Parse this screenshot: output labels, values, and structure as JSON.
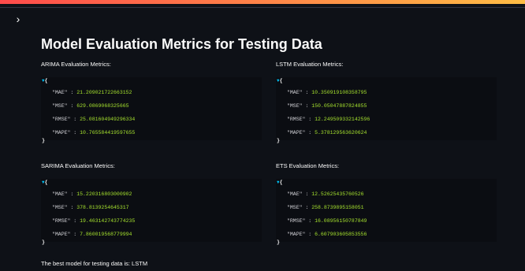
{
  "page": {
    "title": "Model Evaluation Metrics for Testing Data",
    "sidebar_toggle_icon": "chevron-right-icon",
    "sidebar_toggle_glyph": "›"
  },
  "panels": [
    {
      "label": "ARIMA Evaluation Metrics:",
      "open_brace": "{",
      "close_brace": "}",
      "metrics": [
        {
          "key": "\"MAE\"",
          "value": "21.209021722663152"
        },
        {
          "key": "\"MSE\"",
          "value": "629.0869068325665"
        },
        {
          "key": "\"RMSE\"",
          "value": "25.081604949296334"
        },
        {
          "key": "\"MAPE\"",
          "value": "10.765584419597655"
        }
      ]
    },
    {
      "label": "LSTM Evaluation Metrics:",
      "open_brace": "{",
      "close_brace": "}",
      "metrics": [
        {
          "key": "\"MAE\"",
          "value": "10.350919108358795"
        },
        {
          "key": "\"MSE\"",
          "value": "150.05047887824855"
        },
        {
          "key": "\"RMSE\"",
          "value": "12.249509332142596"
        },
        {
          "key": "\"MAPE\"",
          "value": "5.378129563620624"
        }
      ]
    },
    {
      "label": "SARIMA Evaluation Metrics:",
      "open_brace": "{",
      "close_brace": "}",
      "metrics": [
        {
          "key": "\"MAE\"",
          "value": "15.220316803000902"
        },
        {
          "key": "\"MSE\"",
          "value": "378.8139254645317"
        },
        {
          "key": "\"RMSE\"",
          "value": "19.463142743774235"
        },
        {
          "key": "\"MAPE\"",
          "value": "7.860019568779994"
        }
      ]
    },
    {
      "label": "ETS Evaluation Metrics:",
      "open_brace": "{",
      "close_brace": "}",
      "metrics": [
        {
          "key": "\"MAE\"",
          "value": "12.52625435760526"
        },
        {
          "key": "\"MSE\"",
          "value": "258.8739895158051"
        },
        {
          "key": "\"RMSE\"",
          "value": "16.08956150787849"
        },
        {
          "key": "\"MAPE\"",
          "value": "6.607903605853556"
        }
      ]
    }
  ],
  "footer": {
    "text": "The best model for testing data is: LSTM"
  },
  "colors": {
    "background": "#0e1117",
    "json_background": "#0b0d12",
    "json_value": "#a6e22e",
    "caret": "#00c0f2"
  }
}
